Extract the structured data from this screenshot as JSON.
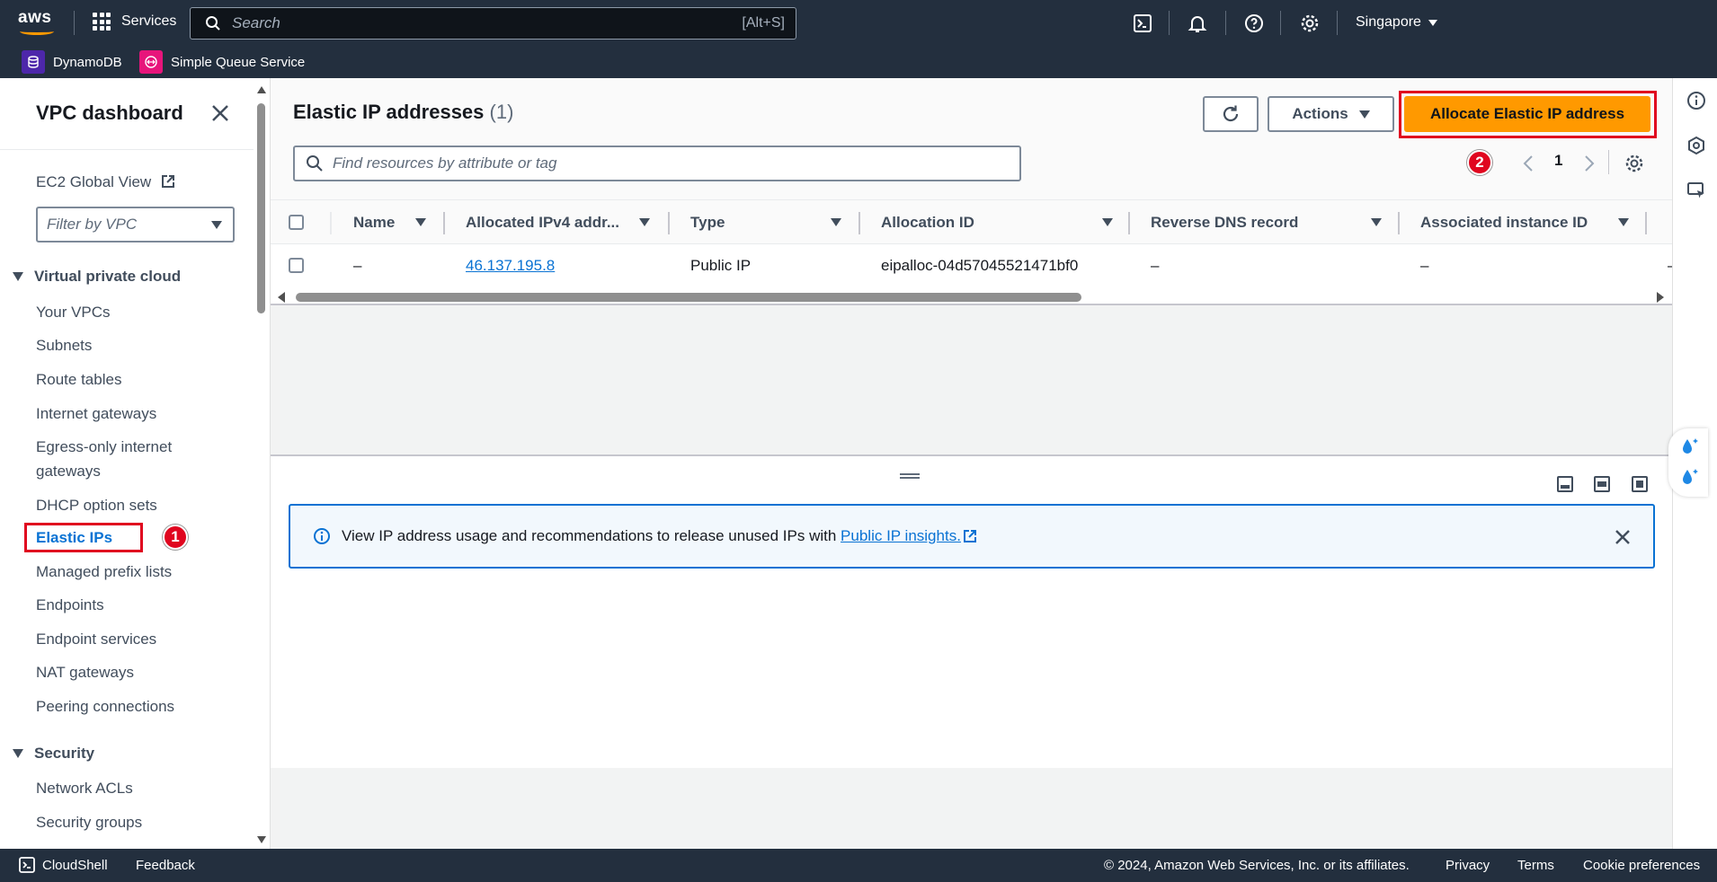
{
  "topbar": {
    "logo_text": "aws",
    "services_label": "Services",
    "search_placeholder": "Search",
    "search_shortcut": "[Alt+S]",
    "region": "Singapore"
  },
  "favorites": [
    {
      "label": "DynamoDB",
      "color": "#4d27aa"
    },
    {
      "label": "Simple Queue Service",
      "color": "#e7157b"
    }
  ],
  "sidebar": {
    "title": "VPC dashboard",
    "global_view": "EC2 Global View",
    "filter_placeholder": "Filter by VPC",
    "sections": [
      {
        "title": "Virtual private cloud",
        "items": [
          "Your VPCs",
          "Subnets",
          "Route tables",
          "Internet gateways",
          "Egress-only internet gateways",
          "DHCP option sets",
          "Elastic IPs",
          "Managed prefix lists",
          "Endpoints",
          "Endpoint services",
          "NAT gateways",
          "Peering connections"
        ]
      },
      {
        "title": "Security",
        "items": [
          "Network ACLs",
          "Security groups"
        ]
      }
    ],
    "active_item": "Elastic IPs"
  },
  "annotations": {
    "badge1": "1",
    "badge2": "2"
  },
  "main": {
    "title": "Elastic IP addresses",
    "count": "(1)",
    "actions_label": "Actions",
    "allocate_label": "Allocate Elastic IP address",
    "search_placeholder": "Find resources by attribute or tag",
    "page_number": "1",
    "columns": [
      "Name",
      "Allocated IPv4 addr...",
      "Type",
      "Allocation ID",
      "Reverse DNS record",
      "Associated instance ID"
    ],
    "rows": [
      {
        "name": "–",
        "ipv4": "46.137.195.8",
        "type": "Public IP",
        "allocation_id": "eipalloc-04d57045521471bf0",
        "reverse_dns": "–",
        "instance_id": "–",
        "extra": "–"
      }
    ],
    "alert": {
      "text": "View IP address usage and recommendations to release unused IPs with ",
      "link": "Public IP insights."
    }
  },
  "footer": {
    "cloudshell": "CloudShell",
    "feedback": "Feedback",
    "copyright": "© 2024, Amazon Web Services, Inc. or its affiliates.",
    "privacy": "Privacy",
    "terms": "Terms",
    "cookies": "Cookie preferences"
  },
  "colors": {
    "accent": "#ff9900",
    "link": "#0972d3",
    "nav": "#232f3e",
    "highlight": "#e0061f"
  }
}
